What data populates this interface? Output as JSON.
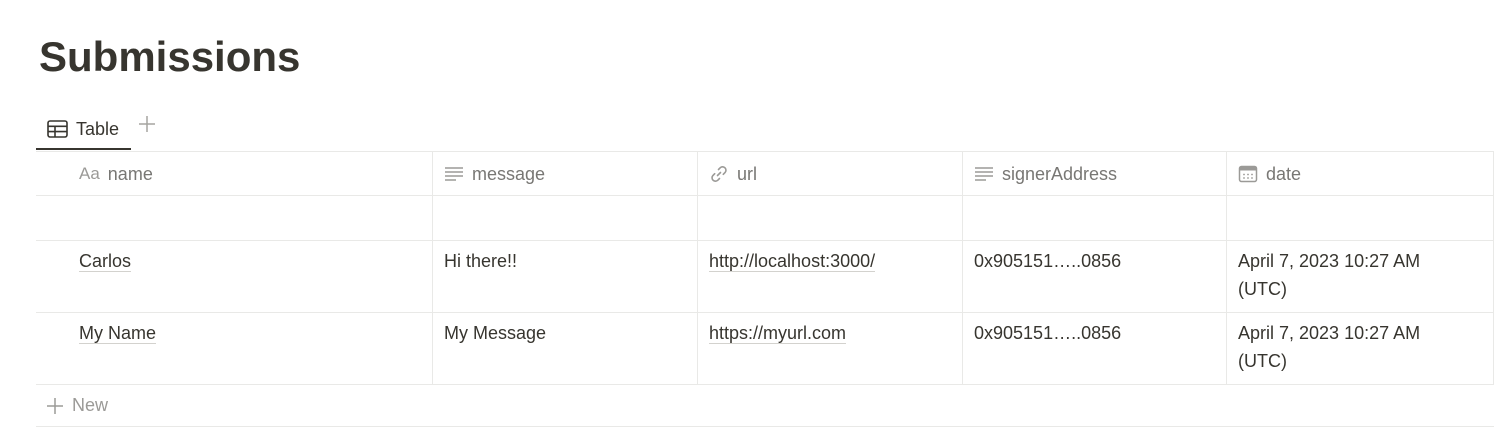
{
  "page": {
    "title": "Submissions"
  },
  "views": {
    "tabs": [
      {
        "label": "Table",
        "icon": "table-icon"
      }
    ],
    "add_icon": "plus-icon"
  },
  "table": {
    "columns": [
      {
        "label": "name",
        "icon": "text-type-icon",
        "icon_text": "Aa"
      },
      {
        "label": "message",
        "icon": "lines-icon"
      },
      {
        "label": "url",
        "icon": "link-icon"
      },
      {
        "label": "signerAddress",
        "icon": "lines-icon"
      },
      {
        "label": "date",
        "icon": "calendar-icon"
      }
    ],
    "rows": [
      {
        "name": "Carlos",
        "message": "Hi there!!",
        "url": "http://localhost:3000/",
        "signerAddress": "0x905151…..0856",
        "date_line1": "April 7, 2023 10:27 AM",
        "date_line2": "(UTC)"
      },
      {
        "name": "My Name",
        "message": "My Message",
        "url": "https://myurl.com",
        "signerAddress": "0x905151…..0856",
        "date_line1": "April 7, 2023 10:27 AM",
        "date_line2": "(UTC)"
      }
    ],
    "new_label": "New"
  },
  "colors": {
    "text": "#37352f",
    "muted": "#787774",
    "border": "#e9e9e7"
  }
}
